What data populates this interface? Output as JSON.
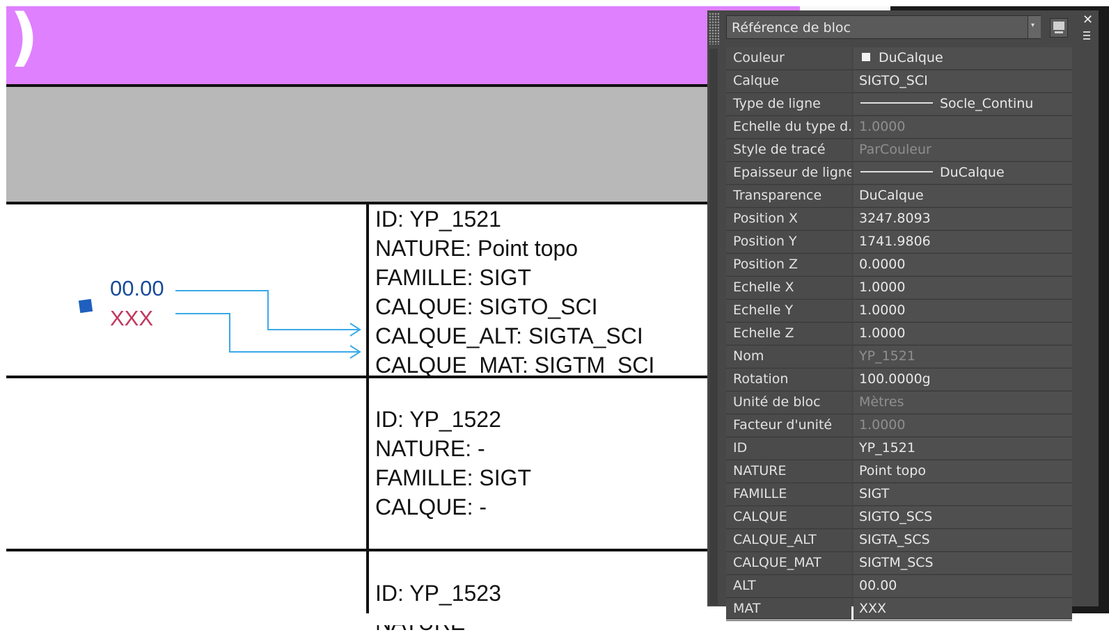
{
  "drawing": {
    "header_glyph": ")",
    "point": {
      "alt_text": "00.00",
      "mat_text": "XXX"
    },
    "blocks": [
      {
        "lines": [
          "ID: YP_1521",
          "NATURE: Point topo",
          "FAMILLE: SIGT",
          "CALQUE: SIGTO_SCI",
          "CALQUE_ALT: SIGTA_SCI",
          "CALQUE_MAT: SIGTM_SCI"
        ]
      },
      {
        "lines": [
          "ID: YP_1522",
          "NATURE: -",
          "FAMILLE: SIGT",
          "CALQUE: -"
        ]
      },
      {
        "lines": [
          "ID: YP_1523",
          "NATURE"
        ]
      }
    ]
  },
  "palette": {
    "selected_object": "Référence de bloc",
    "close_icon": "close-icon",
    "properties": [
      {
        "name": "Couleur",
        "value": "DuCalque",
        "prefix": "swatch"
      },
      {
        "name": "Calque",
        "value": "SIGTO_SCI"
      },
      {
        "name": "Type de ligne",
        "value": "Socle_Continu",
        "prefix": "line"
      },
      {
        "name": "Echelle du type d...",
        "value": "1.0000",
        "dim": true
      },
      {
        "name": "Style de tracé",
        "value": "ParCouleur",
        "dim": true
      },
      {
        "name": "Epaisseur de ligne",
        "value": "DuCalque",
        "prefix": "line"
      },
      {
        "name": "Transparence",
        "value": "DuCalque"
      },
      {
        "name": "Position X",
        "value": "3247.8093"
      },
      {
        "name": "Position Y",
        "value": "1741.9806"
      },
      {
        "name": "Position Z",
        "value": "0.0000"
      },
      {
        "name": "Echelle X",
        "value": "1.0000"
      },
      {
        "name": "Echelle Y",
        "value": "1.0000"
      },
      {
        "name": "Echelle Z",
        "value": "1.0000"
      },
      {
        "name": "Nom",
        "value": "YP_1521",
        "dim": true
      },
      {
        "name": "Rotation",
        "value": "100.0000g"
      },
      {
        "name": "Unité de bloc",
        "value": "Mètres",
        "dim": true
      },
      {
        "name": "Facteur d'unité",
        "value": "1.0000",
        "dim": true
      },
      {
        "name": "ID",
        "value": "YP_1521"
      },
      {
        "name": "NATURE",
        "value": "Point topo"
      },
      {
        "name": "FAMILLE",
        "value": "SIGT"
      },
      {
        "name": "CALQUE",
        "value": "SIGTO_SCS"
      },
      {
        "name": "CALQUE_ALT",
        "value": "SIGTA_SCS"
      },
      {
        "name": "CALQUE_MAT",
        "value": "SIGTM_SCS"
      },
      {
        "name": "ALT",
        "value": "00.00"
      },
      {
        "name": "MAT",
        "value": "XXX"
      }
    ]
  }
}
